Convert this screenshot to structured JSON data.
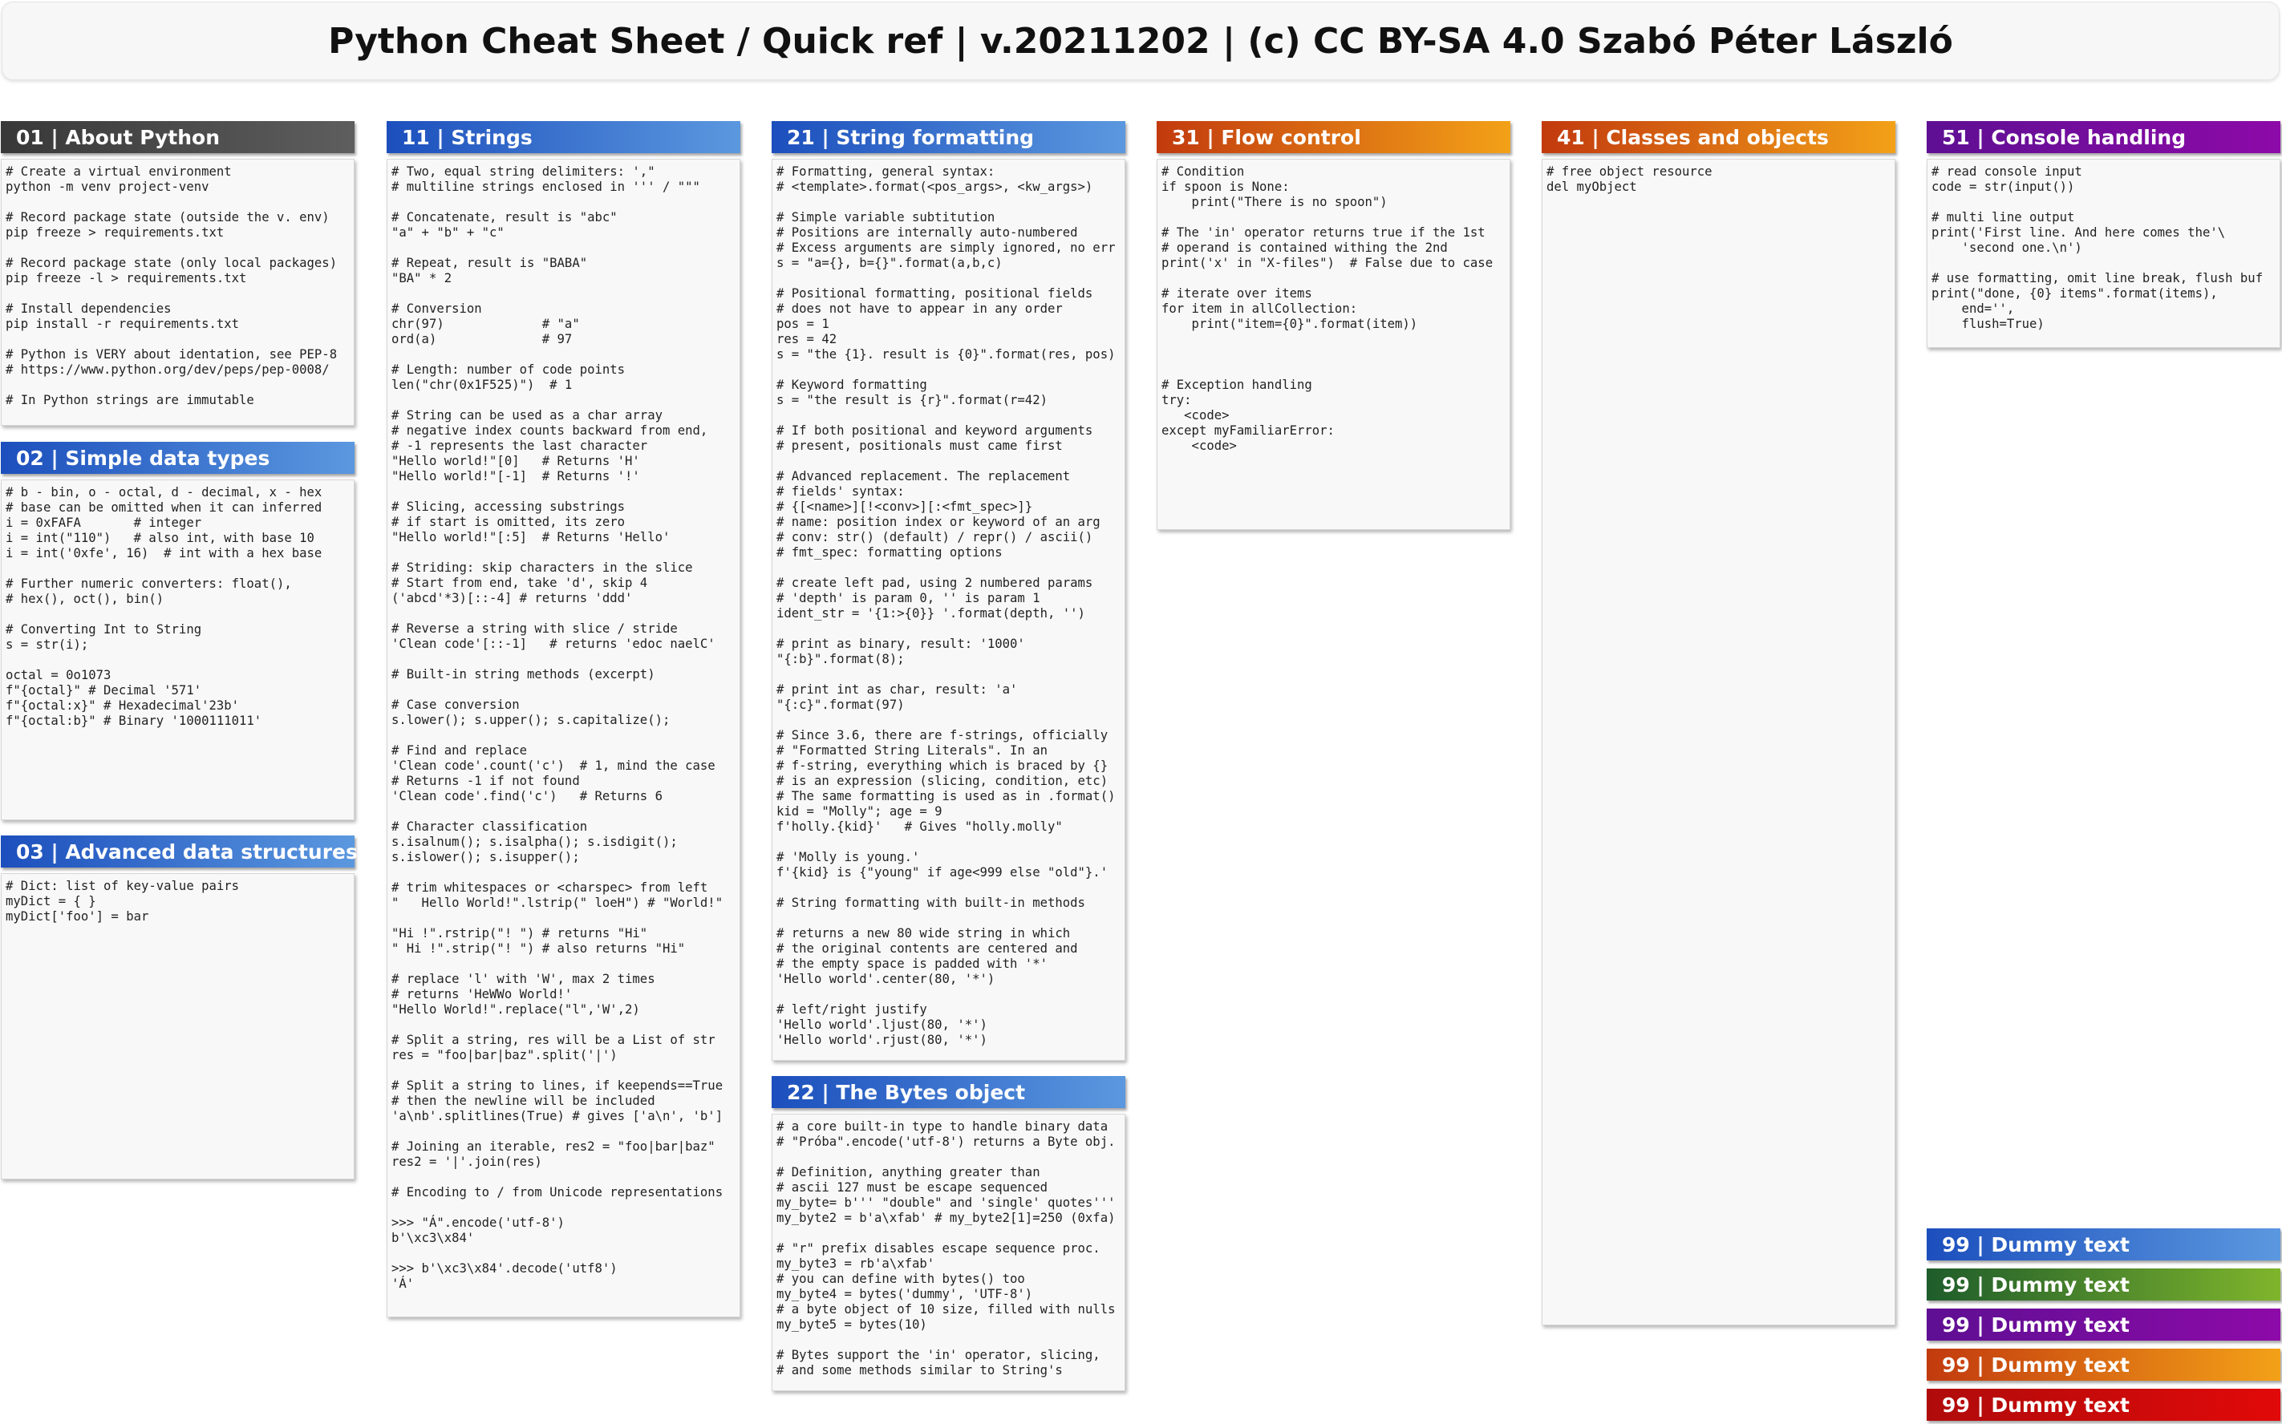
{
  "title": "Python Cheat Sheet / Quick ref | v.20211202 | (c) CC BY-SA 4.0 Szabó Péter László",
  "colors": {
    "dark": "#444444",
    "blue": "#1c4fbd",
    "orange": "#e06c10",
    "purple": "#7a0ba0",
    "green": "#3f8a2c",
    "red": "#d10a0a"
  },
  "sections": {
    "s01": {
      "title": "01 | About Python",
      "body": "# Create a virtual environment\npython -m venv project-venv\n\n# Record package state (outside the v. env)\npip freeze > requirements.txt\n\n# Record package state (only local packages)\npip freeze -l > requirements.txt\n\n# Install dependencies\npip install -r requirements.txt\n\n# Python is VERY about identation, see PEP-8\n# https://www.python.org/dev/peps/pep-0008/\n\n# In Python strings are immutable"
    },
    "s02": {
      "title": "02 | Simple data types",
      "body": "# b - bin, o - octal, d - decimal, x - hex\n# base can be omitted when it can inferred\ni = 0xFAFA       # integer\ni = int(\"110\")   # also int, with base 10\ni = int('0xfe', 16)  # int with a hex base\n\n# Further numeric converters: float(),\n# hex(), oct(), bin()\n\n# Converting Int to String\ns = str(i);\n\noctal = 0o1073\nf\"{octal}\" # Decimal '571'\nf\"{octal:x}\" # Hexadecimal'23b'\nf\"{octal:b}\" # Binary '1000111011'"
    },
    "s03": {
      "title": "03 | Advanced data structures",
      "body": "# Dict: list of key-value pairs\nmyDict = { }\nmyDict['foo'] = bar"
    },
    "s11": {
      "title": "11 | Strings",
      "body": "# Two, equal string delimiters: ',\"\n# multiline strings enclosed in ''' / \"\"\"\n\n# Concatenate, result is \"abc\"\n\"a\" + \"b\" + \"c\"\n\n# Repeat, result is \"BABA\"\n\"BA\" * 2\n\n# Conversion\nchr(97)             # \"a\"\nord(a)              # 97\n\n# Length: number of code points\nlen(\"chr(0x1F525)\")  # 1\n\n# String can be used as a char array\n# negative index counts backward from end,\n# -1 represents the last character\n\"Hello world!\"[0]   # Returns 'H'\n\"Hello world!\"[-1]  # Returns '!'\n\n# Slicing, accessing substrings\n# if start is omitted, its zero\n\"Hello world!\"[:5]  # Returns 'Hello'\n\n# Striding: skip characters in the slice\n# Start from end, take 'd', skip 4\n('abcd'*3)[::-4] # returns 'ddd'\n\n# Reverse a string with slice / stride\n'Clean code'[::-1]   # returns 'edoc naelC'\n\n# Built-in string methods (excerpt)\n\n# Case conversion\ns.lower(); s.upper(); s.capitalize();\n\n# Find and replace\n'Clean code'.count('c')  # 1, mind the case\n# Returns -1 if not found\n'Clean code'.find('c')   # Returns 6\n\n# Character classification\ns.isalnum(); s.isalpha(); s.isdigit();\ns.islower(); s.isupper();\n\n# trim whitespaces or <charspec> from left\n\"   Hello World!\".lstrip(\" loeH\") # \"World!\"\n\n\"Hi !\".rstrip(\"! \") # returns \"Hi\"\n\" Hi !\".strip(\"! \") # also returns \"Hi\"\n\n# replace 'l' with 'W', max 2 times\n# returns 'HeWWo World!'\n\"Hello World!\".replace(\"l\",'W',2)\n\n# Split a string, res will be a List of str\nres = \"foo|bar|baz\".split('|')\n\n# Split a string to lines, if keepends==True\n# then the newline will be included\n'a\\nb'.splitlines(True) # gives ['a\\n', 'b']\n\n# Joining an iterable, res2 = \"foo|bar|baz\"\nres2 = '|'.join(res)\n\n# Encoding to / from Unicode representations\n\n>>> \"Á\".encode('utf-8')\nb'\\xc3\\x84'\n\n>>> b'\\xc3\\x84'.decode('utf8')\n'Á'"
    },
    "s21": {
      "title": "21 | String formatting",
      "body": "# Formatting, general syntax:\n# <template>.format(<pos_args>, <kw_args>)\n\n# Simple variable subtitution\n# Positions are internally auto-numbered\n# Excess arguments are simply ignored, no err\ns = \"a={}, b={}\".format(a,b,c)\n\n# Positional formatting, positional fields\n# does not have to appear in any order\npos = 1\nres = 42\ns = \"the {1}. result is {0}\".format(res, pos)\n\n# Keyword formatting\ns = \"the result is {r}\".format(r=42)\n\n# If both positional and keyword arguments\n# present, positionals must came first\n\n# Advanced replacement. The replacement\n# fields' syntax:\n# {[<name>][!<conv>][:<fmt_spec>]}\n# name: position index or keyword of an arg\n# conv: str() (default) / repr() / ascii()\n# fmt_spec: formatting options\n\n# create left pad, using 2 numbered params\n# 'depth' is param 0, '' is param 1\nident_str = '{1:>{0}} '.format(depth, '')\n\n# print as binary, result: '1000'\n\"{:b}\".format(8);\n\n# print int as char, result: 'a'\n\"{:c}\".format(97)\n\n# Since 3.6, there are f-strings, officially\n# \"Formatted String Literals\". In an\n# f-string, everything which is braced by {}\n# is an expression (slicing, condition, etc)\n# The same formatting is used as in .format()\nkid = \"Molly\"; age = 9\nf'holly.{kid}'   # Gives \"holly.molly\"\n\n# 'Molly is young.'\nf'{kid} is {\"young\" if age<999 else \"old\"}.'\n\n# String formatting with built-in methods\n\n# returns a new 80 wide string in which\n# the original contents are centered and\n# the empty space is padded with '*'\n'Hello world'.center(80, '*')\n\n# left/right justify\n'Hello world'.ljust(80, '*')\n'Hello world'.rjust(80, '*')"
    },
    "s22": {
      "title": "22 | The Bytes object",
      "body": "# a core built-in type to handle binary data\n# \"Próba\".encode('utf-8') returns a Byte obj.\n\n# Definition, anything greater than\n# ascii 127 must be escape sequenced\nmy_byte= b''' \"double\" and 'single' quotes'''\nmy_byte2 = b'a\\xfab' # my_byte2[1]=250 (0xfa)\n\n# \"r\" prefix disables escape sequence proc.\nmy_byte3 = rb'a\\xfab'\n# you can define with bytes() too\nmy_byte4 = bytes('dummy', 'UTF-8')\n# a byte object of 10 size, filled with nulls\nmy_byte5 = bytes(10)\n\n# Bytes support the 'in' operator, slicing,\n# and some methods similar to String's"
    },
    "s31": {
      "title": "31 | Flow control",
      "body": "# Condition\nif spoon is None:\n    print(\"There is no spoon\")\n\n# The 'in' operator returns true if the 1st\n# operand is contained withing the 2nd\nprint('x' in \"X-files\")  # False due to case\n\n# iterate over items\nfor item in allCollection:\n    print(\"item={0}\".format(item))\n\n\n\n# Exception handling\ntry:\n   <code>\nexcept myFamiliarError:\n    <code>"
    },
    "s41": {
      "title": "41 | Classes and objects",
      "body": "# free object resource\ndel myObject"
    },
    "s51": {
      "title": "51 | Console handling",
      "body": "# read console input\ncode = str(input())\n\n# multi line output\nprint('First line. And here comes the'\\\n    'second one.\\n')\n\n# use formatting, omit line break, flush buf\nprint(\"done, {0} items\".format(items),\n    end='',\n    flush=True)"
    }
  },
  "dummy": [
    {
      "title": "99 | Dummy text",
      "color": "blue"
    },
    {
      "title": "99 | Dummy text",
      "color": "green"
    },
    {
      "title": "99 | Dummy text",
      "color": "purple"
    },
    {
      "title": "99 | Dummy text",
      "color": "orange"
    },
    {
      "title": "99 | Dummy text",
      "color": "red"
    }
  ]
}
